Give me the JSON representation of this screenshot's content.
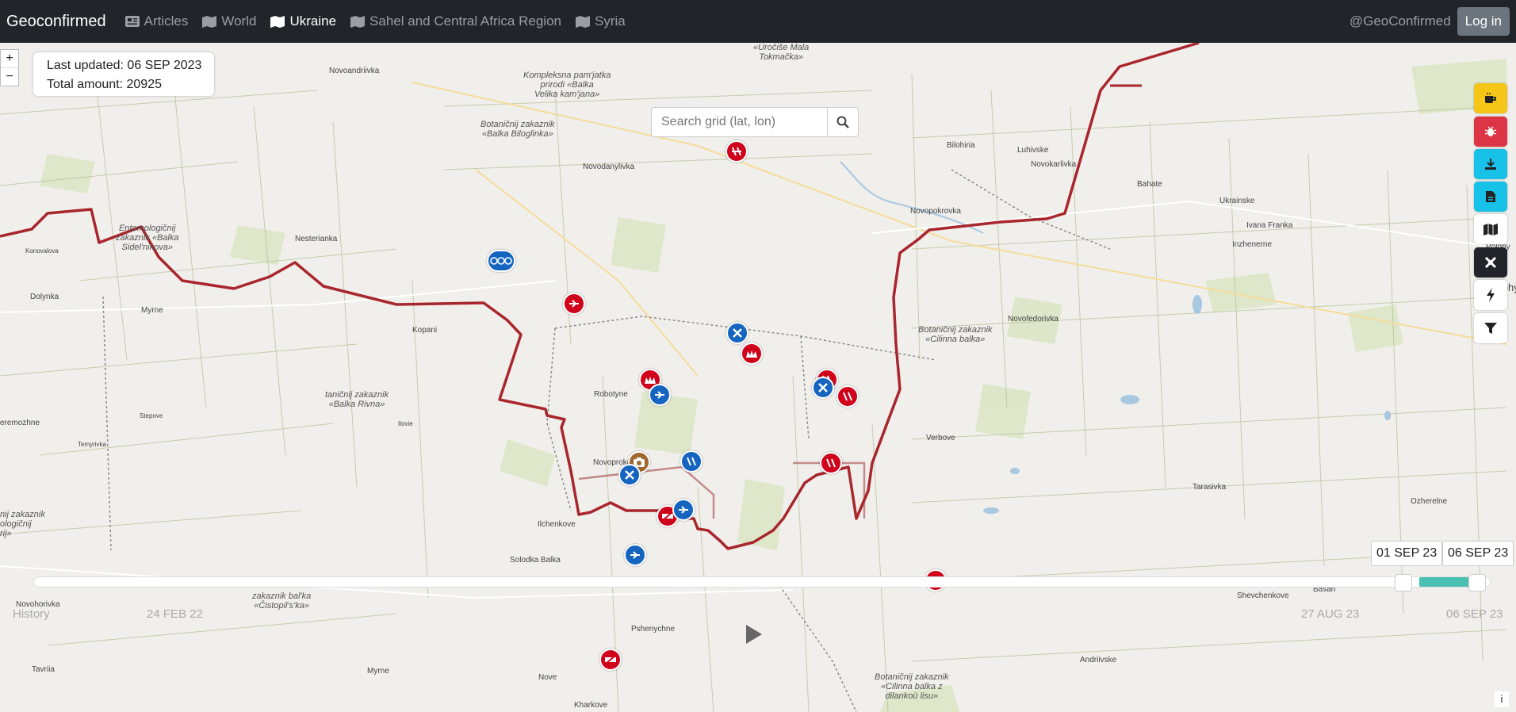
{
  "navbar": {
    "brand": "Geoconfirmed",
    "items": [
      {
        "label": "Articles",
        "icon": "newspaper-icon",
        "active": false
      },
      {
        "label": "World",
        "icon": "map-icon",
        "active": false
      },
      {
        "label": "Ukraine",
        "icon": "map-icon",
        "active": true
      },
      {
        "label": "Sahel and Central Africa Region",
        "icon": "map-icon",
        "active": false
      },
      {
        "label": "Syria",
        "icon": "map-icon",
        "active": false
      }
    ],
    "handle": "@GeoConfirmed",
    "login_label": "Log in"
  },
  "zoom": {
    "in": "+",
    "out": "−"
  },
  "info": {
    "last_updated": "Last updated: 06 SEP 2023",
    "total": "Total amount: 20925"
  },
  "search": {
    "placeholder": "Search grid (lat, lon)"
  },
  "right_buttons": [
    {
      "name": "coffee-icon",
      "color": "#f5c518"
    },
    {
      "name": "bug-icon",
      "color": "#dc3545"
    },
    {
      "name": "download-icon",
      "color": "#17c1e8"
    },
    {
      "name": "file-icon",
      "color": "#17c1e8"
    },
    {
      "name": "map-icon",
      "color": "#ffffff"
    },
    {
      "name": "satellite-icon",
      "color": "#212529"
    },
    {
      "name": "bolt-icon",
      "color": "#ffffff"
    },
    {
      "name": "filter-icon",
      "color": "#ffffff"
    }
  ],
  "places": [
    {
      "t": "Novoandriivka"
    },
    {
      "t": "Nesterianka"
    },
    {
      "t": "Konovalova"
    },
    {
      "t": "Dolynka"
    },
    {
      "t": "Myrne"
    },
    {
      "t": "Kopani"
    },
    {
      "t": "Stepove"
    },
    {
      "t": "Temyrivka"
    },
    {
      "t": "Ilovie"
    },
    {
      "t": "eremozhne"
    },
    {
      "t": "Novodanylivka"
    },
    {
      "t": "Robotyne"
    },
    {
      "t": "Novoprokopivka"
    },
    {
      "t": "Ilchenkove"
    },
    {
      "t": "Solodka Balka"
    },
    {
      "t": "Pshenychne"
    },
    {
      "t": "Novohorivka"
    },
    {
      "t": "Tavriia"
    },
    {
      "t": "Myrne"
    },
    {
      "t": "Nove"
    },
    {
      "t": "Kharkove"
    },
    {
      "t": "Bilohiria"
    },
    {
      "t": "Luhivske"
    },
    {
      "t": "Bahate"
    },
    {
      "t": "Novokarlivka"
    },
    {
      "t": "Ukrainske"
    },
    {
      "t": "Novopokrovka"
    },
    {
      "t": "Ivana Franka"
    },
    {
      "t": "Inzhenerne"
    },
    {
      "t": "Polohy"
    },
    {
      "t": "Polohy"
    },
    {
      "t": "Novofedorivka"
    },
    {
      "t": "Verbove"
    },
    {
      "t": "Tarasivka"
    },
    {
      "t": "Ozherelne"
    },
    {
      "t": "Basan"
    },
    {
      "t": "Shevchenkove"
    },
    {
      "t": "Andriivske"
    }
  ],
  "reserves": [
    {
      "t": "Kompleksna pam'jatka\nprirodi «Balka\nVelika kam'jana»"
    },
    {
      "t": "Botaničnij zakaznik\n«Balka Biloglinka»"
    },
    {
      "t": "Entomologičnij\nzakaznik «Balka\nSidel'nikova»"
    },
    {
      "t": "taničnij zakaznik\n«Balka Rivna»"
    },
    {
      "t": "nij zakaznik\nologičnij\nrij»"
    },
    {
      "t": "zakaznik bal'ka\n«Čistopil's'ka»"
    },
    {
      "t": "«Uročiše Mala\nTokmačka»"
    },
    {
      "t": "Botaničnij zakaznik\n«Cilinna balka»"
    },
    {
      "t": "Botaničnij zakaznik\n«Cilinna balka z\ndilankoü lisu»"
    }
  ],
  "markers": [
    {
      "name": "destroyed-vehicle-icon",
      "color": "#d0021b"
    },
    {
      "name": "drone-icon",
      "color": "#1565c0"
    },
    {
      "name": "aircraft-icon",
      "color": "#d0021b"
    },
    {
      "name": "crossed-tools-icon",
      "color": "#1565c0"
    },
    {
      "name": "fortification-icon",
      "color": "#d0021b"
    },
    {
      "name": "fortification-icon",
      "color": "#d0021b"
    },
    {
      "name": "aircraft-icon",
      "color": "#1565c0"
    },
    {
      "name": "destroyed-vehicle-icon",
      "color": "#d0021b"
    },
    {
      "name": "crossed-tools-icon",
      "color": "#1565c0"
    },
    {
      "name": "destroyed-vehicle-icon",
      "color": "#d0021b"
    },
    {
      "name": "destroyed-vehicle-icon",
      "color": "#1565c0"
    },
    {
      "name": "destroyed-vehicle-icon",
      "color": "#d0021b"
    },
    {
      "name": "camera-icon",
      "color": "#a0672c"
    },
    {
      "name": "crossed-tools-icon",
      "color": "#1565c0"
    },
    {
      "name": "damaged-vehicle-icon",
      "color": "#d0021b"
    },
    {
      "name": "aircraft-icon",
      "color": "#1565c0"
    },
    {
      "name": "aircraft-icon",
      "color": "#1565c0"
    },
    {
      "name": "damaged-vehicle-icon",
      "color": "#d0021b"
    },
    {
      "name": "damaged-vehicle-icon",
      "color": "#d0021b"
    }
  ],
  "timeline": {
    "start_date": "01 SEP 23",
    "end_date": "06 SEP 23",
    "ticks": [
      "History",
      "24 FEB 22",
      "27 AUG 23",
      "06 SEP 23"
    ]
  },
  "info_button": "i"
}
